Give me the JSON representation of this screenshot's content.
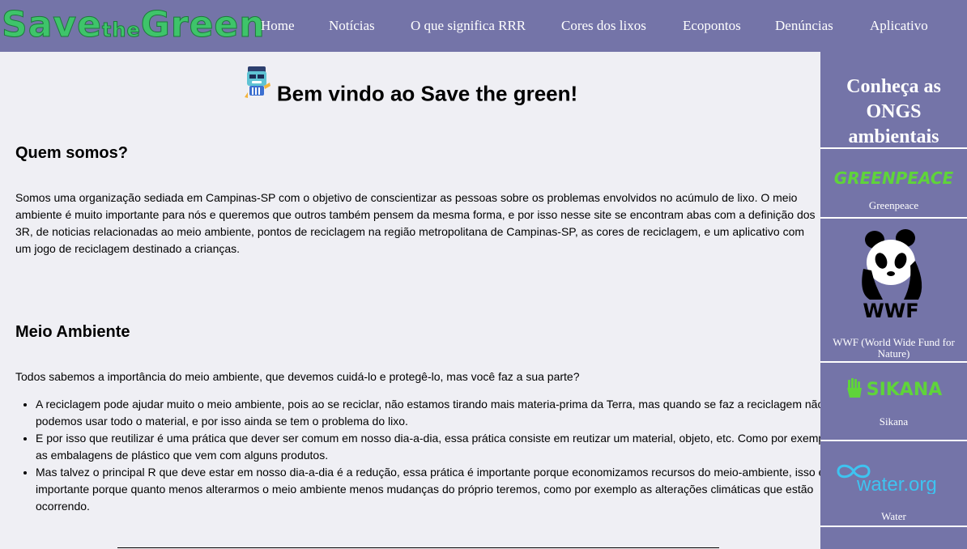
{
  "header": {
    "logo": {
      "part1": "Save",
      "part2": "the",
      "part3": "Green"
    },
    "nav": [
      "Home",
      "Notícias",
      "O que significa RRR",
      "Cores dos lixos",
      "Ecopontos",
      "Denúncias",
      "Aplicativo"
    ]
  },
  "main": {
    "welcome": "Bem vindo ao Save the green!",
    "about_title": "Quem somos?",
    "about_text": "Somos uma organização sediada em Campinas-SP com o objetivo de conscientizar as pessoas sobre os problemas envolvidos no acúmulo de lixo. O meio ambiente é muito importante para nós e queremos que outros também pensem da mesma forma, e por isso nesse site se encontram abas com a definição dos 3R, de noticias relacionadas ao meio ambiente, pontos de reciclagem na região metropolitana de Campinas-SP, as cores de reciclagem, e um aplicativo com um jogo de reciclagem destinado a crianças.",
    "env_title": "Meio Ambiente",
    "env_intro": "Todos sabemos a importância do meio ambiente, que devemos cuidá-lo e protegê-lo, mas você faz a sua parte?",
    "bullets": [
      "A reciclagem pode ajudar muito o meio ambiente, pois ao se reciclar, não estamos tirando mais materia-prima da Terra, mas quando se faz a reciclagem não podemos usar todo o material, e por isso ainda se tem o problema do lixo.",
      "E por isso que reutilizar é uma prática que dever ser comum em nosso dia-a-dia, essa prática consiste em reutizar um material, objeto, etc. Como por exemplo as embalagens de plástico que vem com alguns produtos.",
      "Mas talvez o principal R que deve estar em nosso dia-a-dia é a redução, essa prática é importante porque economizamos recursos do meio-ambiente, isso é importante porque quanto menos alterarmos o meio ambiente menos mudanças do próprio teremos, como por exemplo as alterações climáticas que estão ocorrendo."
    ]
  },
  "sidebar": {
    "title": "Conheça as ONGS ambientais",
    "ongs": [
      {
        "logo_text": "GREENPEACE",
        "name": "Greenpeace"
      },
      {
        "logo_text": "WWF",
        "name": "WWF (World Wide Fund for Nature)"
      },
      {
        "logo_text": "SIKANA",
        "name": "Sikana"
      },
      {
        "logo_text": "water.org",
        "name": "Water"
      }
    ]
  },
  "colors": {
    "nav_bg": "#7474a8",
    "page_bg": "#efeff4",
    "logo_green": "#3ec46a",
    "greenpeace_green": "#5fd43a"
  }
}
